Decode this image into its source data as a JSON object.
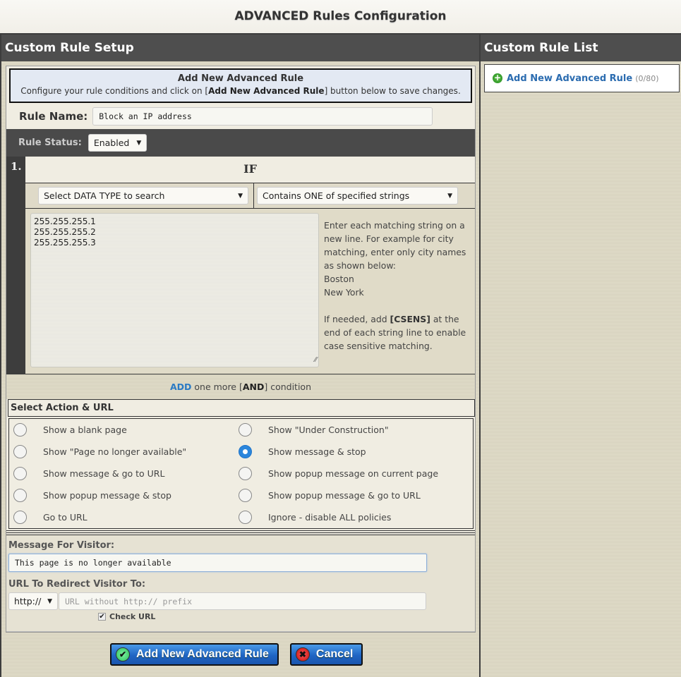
{
  "page": {
    "title": "ADVANCED Rules Configuration"
  },
  "left": {
    "title": "Custom Rule Setup",
    "intro": {
      "heading": "Add New Advanced Rule",
      "text_before": "Configure your rule conditions and click on [",
      "text_bold": "Add New Advanced Rule",
      "text_after": "] button below to save changes."
    },
    "rule_name": {
      "label": "Rule Name:",
      "value": "Block an IP address"
    },
    "rule_status": {
      "label": "Rule Status:",
      "value": "Enabled"
    },
    "condition": {
      "number": "1.",
      "if_label": "IF",
      "data_type_select": "Select DATA TYPE to search",
      "match_select": "Contains ONE of specified strings",
      "strings": "255.255.255.1\n255.255.255.2\n255.255.255.3",
      "help_lines": [
        "Enter each matching string on a",
        "new line. For example for city",
        "matching, enter only city names",
        "as shown below:",
        "Boston",
        "New York"
      ],
      "help_csens_before": "If needed, add ",
      "help_csens_bold": "[CSENS]",
      "help_csens_after": " at the end of each string line to enable case sensitive matching."
    },
    "add_condition": {
      "link": "ADD",
      "before_bold": " one more [",
      "bold": "AND",
      "after": "] condition"
    },
    "action": {
      "heading": "Select Action & URL",
      "options": [
        {
          "label": "Show a blank page",
          "checked": false
        },
        {
          "label": "Show \"Under Construction\"",
          "checked": false
        },
        {
          "label": "Show \"Page no longer available\"",
          "checked": false
        },
        {
          "label": "Show message & stop",
          "checked": true
        },
        {
          "label": "Show message & go to URL",
          "checked": false
        },
        {
          "label": "Show popup message on current page",
          "checked": false
        },
        {
          "label": "Show popup message & stop",
          "checked": false
        },
        {
          "label": "Show popup message & go to URL",
          "checked": false
        },
        {
          "label": "Go to URL",
          "checked": false
        },
        {
          "label": "Ignore - disable ALL policies",
          "checked": false
        }
      ]
    },
    "message": {
      "label": "Message For Visitor:",
      "value": "This page is no longer available"
    },
    "url": {
      "label": "URL To Redirect Visitor To:",
      "protocol": "http://",
      "placeholder": "URL without http:// prefix",
      "value": "",
      "check_label": "Check URL",
      "check_checked": true
    },
    "buttons": {
      "add": "Add New Advanced Rule",
      "cancel": "Cancel"
    }
  },
  "right": {
    "title": "Custom Rule List",
    "add_link": "Add New Advanced Rule",
    "count": "(0/80)"
  },
  "colors": {
    "accent_blue": "#2a7ac4",
    "dark_header": "#4e4e4e",
    "button_blue": "#1f65c4"
  }
}
